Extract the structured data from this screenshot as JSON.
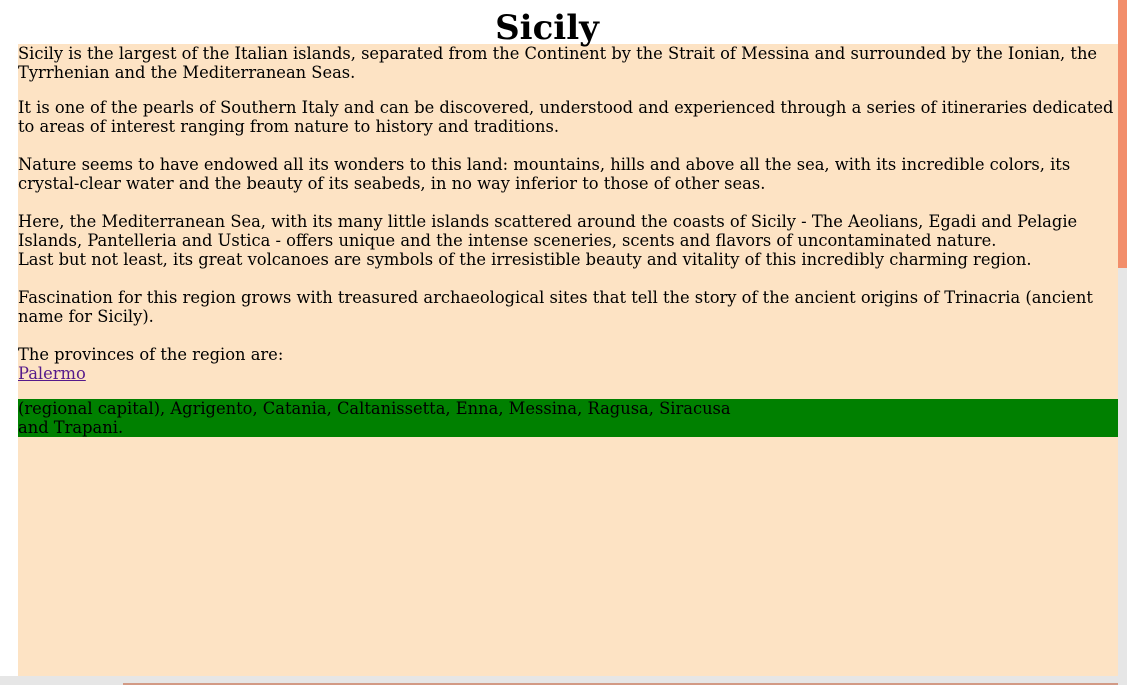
{
  "page": {
    "title": "Sicily",
    "paragraphs": [
      "Sicily is the largest of the Italian islands, separated from the Continent by the Strait of Messina and surrounded by the Ionian, the Tyrrhenian and the Mediterranean Seas.",
      "It is one of the pearls of Southern Italy and can be discovered, understood and experienced through a series of itineraries dedicated to areas of interest ranging from nature to history and traditions.",
      "Nature seems to have endowed all its wonders to this land: mountains, hills and above all the sea, with its incredible colors, its crystal-clear water and the beauty of its seabeds, in no way inferior to those of other seas.",
      "Here, the Mediterranean Sea, with its many little islands scattered around the coasts of Sicily - The Aeolians, Egadi and Pelagie Islands, Pantelleria and Ustica - offers unique and the intense sceneries, scents and flavors of uncontaminated nature.",
      "Last but not least, its great volcanoes are symbols of the irresistible beauty and vitality of this incredibly charming region.",
      "Fascination for this region grows with treasured archaeological sites that tell the story of the ancient origins of Trinacria (ancient name for Sicily)."
    ],
    "provinces_intro": "The provinces of the region are:",
    "provinces_link": "Palermo",
    "provinces_rest": " (regional capital), Agrigento, Catania, Caltanissetta, Enna, Messina, Ragusa, Siracusa and Trapani."
  },
  "colors": {
    "content_bg": "#fde3c4",
    "highlight_box": "#008000",
    "link": "#551a8b",
    "scrollbar_thumb": "#f28e6b"
  }
}
